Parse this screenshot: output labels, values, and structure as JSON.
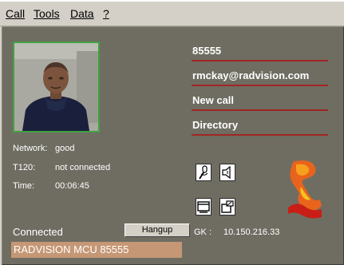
{
  "menu": {
    "items": [
      {
        "label": "Call"
      },
      {
        "label": "Tools"
      },
      {
        "label": "Data"
      },
      {
        "label": "?"
      }
    ]
  },
  "info": {
    "network_label": "Network:",
    "network_value": "good",
    "t120_label": "T120:",
    "t120_value": "not connected",
    "time_label": "Time:",
    "time_value": "00:06:45"
  },
  "fields": {
    "number": "85555",
    "email": "rmckay@radvision.com",
    "new_call": "New call",
    "directory": "Directory"
  },
  "call": {
    "status": "Connected",
    "hangup_label": "Hangup",
    "remote_party": "RADVISION MCU 85555",
    "gk_label": "GK :",
    "gk_value": "10.150.216.33"
  },
  "icons": {
    "mic": "microphone-icon",
    "speaker": "speaker-icon",
    "window": "window-icon",
    "external": "external-window-icon",
    "logo": "radvision-logo"
  },
  "colors": {
    "panel": "#6f6d62",
    "accent_line": "#a02622",
    "status_bar": "#c59775",
    "video_border": "#3fa33f"
  }
}
